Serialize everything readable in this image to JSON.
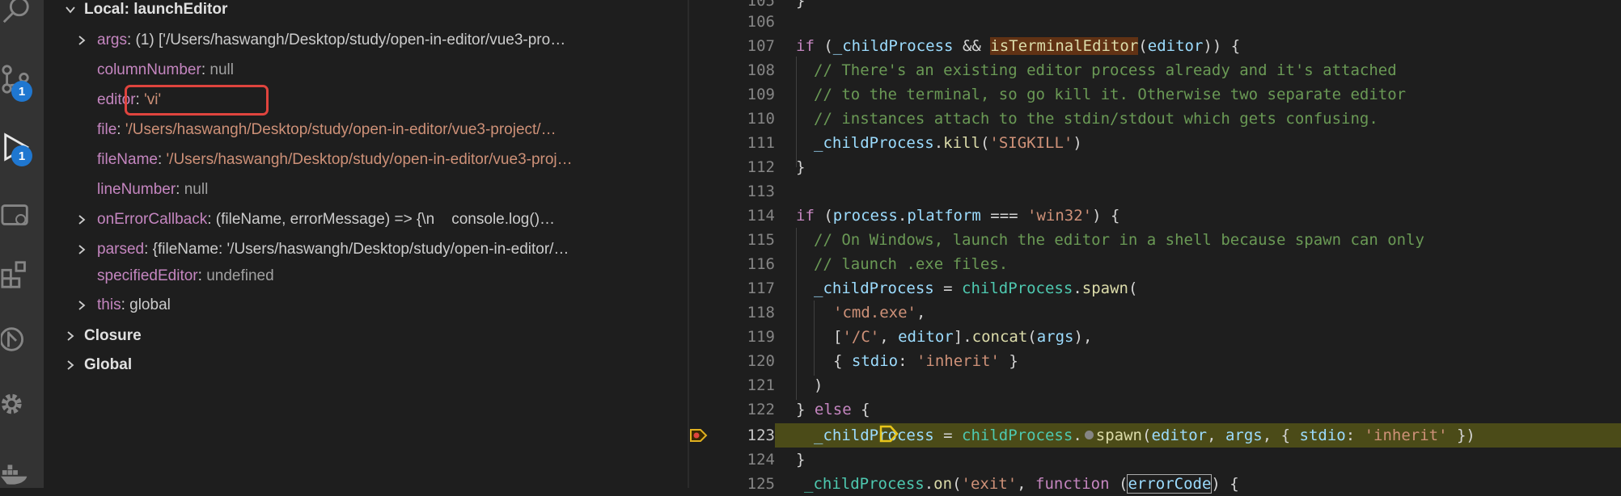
{
  "activity_bar": {
    "badges": {
      "source_control": "1",
      "run_debug": "1"
    }
  },
  "variables": {
    "scope_local_label": "Local: launchEditor",
    "items": [
      {
        "name": "args",
        "sep": ": ",
        "value": "(1) ['/Users/haswangh/Desktop/study/open-in-editor/vue3-pro…",
        "kind": "plain",
        "expandable": true
      },
      {
        "name": "columnNumber",
        "sep": ": ",
        "value": "null",
        "kind": "null",
        "expandable": false
      },
      {
        "name": "editor",
        "sep": ": ",
        "value": "'vi'",
        "kind": "str",
        "expandable": false
      },
      {
        "name": "file",
        "sep": ": ",
        "value": "'/Users/haswangh/Desktop/study/open-in-editor/vue3-project/…",
        "kind": "str",
        "expandable": false
      },
      {
        "name": "fileName",
        "sep": ": ",
        "value": "'/Users/haswangh/Desktop/study/open-in-editor/vue3-proj…",
        "kind": "str",
        "expandable": false
      },
      {
        "name": "lineNumber",
        "sep": ": ",
        "value": "null",
        "kind": "null",
        "expandable": false
      },
      {
        "name": "onErrorCallback",
        "sep": ": ",
        "value": "(fileName, errorMessage) => {\\n    console.log()…",
        "kind": "plain",
        "expandable": true
      },
      {
        "name": "parsed",
        "sep": ": ",
        "value": "{fileName: '/Users/haswangh/Desktop/study/open-in-editor/…",
        "kind": "plain",
        "expandable": true
      },
      {
        "name": "specifiedEditor",
        "sep": ": ",
        "value": "undefined",
        "kind": "null",
        "expandable": false
      },
      {
        "name": "this",
        "sep": ": ",
        "value": "global",
        "kind": "plain",
        "expandable": true
      }
    ],
    "scope_closure_label": "Closure",
    "scope_global_label": "Global"
  },
  "editor": {
    "partial_top_line_number": "105",
    "partial_top_text": "}",
    "line_numbers": [
      "106",
      "107",
      "108",
      "109",
      "110",
      "111",
      "112",
      "113",
      "114",
      "115",
      "116",
      "117",
      "118",
      "119",
      "120",
      "121",
      "122",
      "123",
      "124",
      "125"
    ],
    "current_line": "123",
    "l107": {
      "kw": "if",
      "p1": " (",
      "v1": "_childProcess",
      "p2": " && ",
      "fn": "isTerminalEditor",
      "p3": "(",
      "v2": "editor",
      "p4": ")) {"
    },
    "l108": "// There's an existing editor process already and it's attached",
    "l109": "// to the terminal, so go kill it. Otherwise two separate editor",
    "l110": "// instances attach to the stdin/stdout which gets confusing.",
    "l111": {
      "v1": "_childProcess",
      "p1": ".",
      "fn": "kill",
      "p2": "(",
      "s1": "'SIGKILL'",
      "p3": ")"
    },
    "l112": "}",
    "l114": {
      "kw": "if",
      "p1": " (",
      "v1": "process",
      "p2": ".",
      "v2": "platform",
      "p3": " === ",
      "s1": "'win32'",
      "p4": ") {"
    },
    "l115": "// On Windows, launch the editor in a shell because spawn can only",
    "l116": "// launch .exe files.",
    "l117": {
      "v1": "_childProcess",
      "p1": " = ",
      "o1": "childProcess",
      "p2": ".",
      "fn": "spawn",
      "p3": "("
    },
    "l118": {
      "s1": "'cmd.exe'",
      "p1": ","
    },
    "l119": {
      "p1": "[",
      "s1": "'/C'",
      "p2": ", ",
      "v1": "editor",
      "p3": "].",
      "fn": "concat",
      "p4": "(",
      "v2": "args",
      "p5": "),"
    },
    "l120": {
      "p1": "{ ",
      "v1": "stdio",
      "p2": ": ",
      "s1": "'inherit'",
      "p3": " }"
    },
    "l121": ")",
    "l122": {
      "p1": "} ",
      "kw": "else",
      "p2": " {"
    },
    "l123": {
      "v1": "_childProcess",
      "p1": " = ",
      "o1": "childProcess",
      "p2": ".",
      "fn": "spawn",
      "p3": "(",
      "v2": "editor",
      "p4": ", ",
      "v3": "args",
      "p5": ", { ",
      "v4": "stdio",
      "p6": ": ",
      "s1": "'inherit'",
      "p7": " })"
    },
    "l124": "}",
    "l125": {
      "o1": "_childProcess",
      "p1": ".",
      "fn": "on",
      "p2": "(",
      "s1": "'exit'",
      "p3": ", ",
      "kw": "function",
      "p4": " (",
      "v1": "errorCode",
      "p5": ") {"
    }
  }
}
